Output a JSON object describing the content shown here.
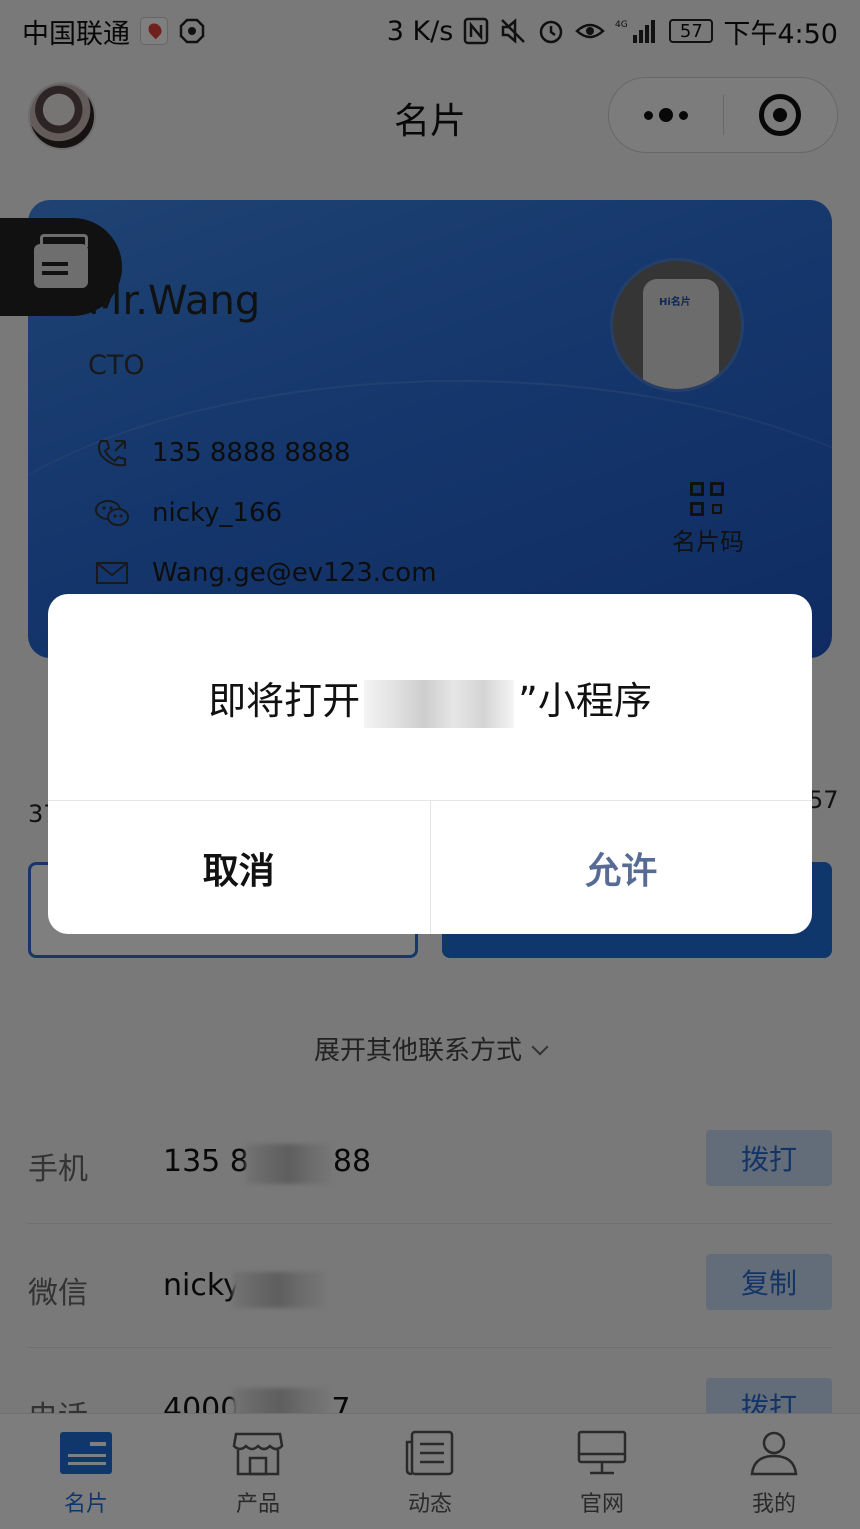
{
  "status_bar": {
    "carrier": "中国联通",
    "speed": "3 K/s",
    "network": "4G",
    "battery": "57",
    "time": "下午4:50"
  },
  "nav": {
    "title": "名片"
  },
  "card": {
    "name": "Mr.Wang",
    "title": "CTO",
    "phone": "135 8888 8888",
    "wechat": "nicky_166",
    "email": "Wang.ge@ev123.com",
    "qr_label": "名片码",
    "photo_logo": "Hi名片"
  },
  "partial": {
    "left_number": "37",
    "right_number": "57"
  },
  "expand_label": "展开其他联系方式",
  "contacts": [
    {
      "label": "手机",
      "value_start": "135 8",
      "value_end": "88",
      "action": "拨打"
    },
    {
      "label": "微信",
      "value_start": "nicky",
      "value_end": "",
      "action": "复制"
    },
    {
      "label": "电话",
      "value_start": "4000",
      "value_end": "7",
      "action": "拨打"
    }
  ],
  "tabs": [
    {
      "label": "名片",
      "icon": "card-icon",
      "active": true
    },
    {
      "label": "产品",
      "icon": "store-icon",
      "active": false
    },
    {
      "label": "动态",
      "icon": "news-icon",
      "active": false
    },
    {
      "label": "官网",
      "icon": "monitor-icon",
      "active": false
    },
    {
      "label": "我的",
      "icon": "person-icon",
      "active": false
    }
  ],
  "dialog": {
    "message_prefix": "即将打开",
    "message_suffix": "”小程序",
    "cancel_label": "取消",
    "allow_label": "允许"
  },
  "colors": {
    "accent": "#1f6fd8",
    "card_blue": "#2a6ed9",
    "dialog_allow": "#576b95"
  }
}
